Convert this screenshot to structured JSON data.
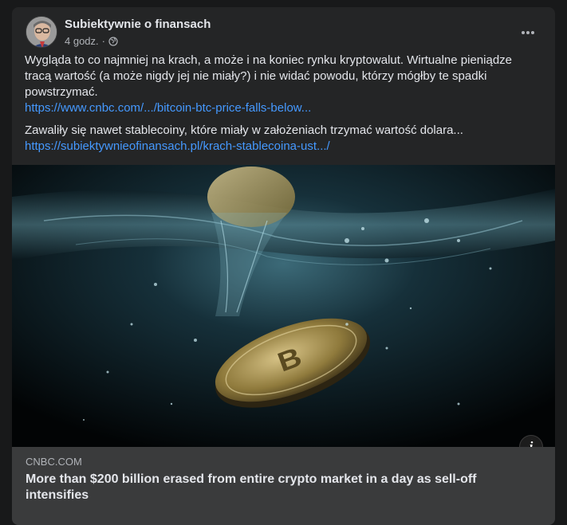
{
  "post": {
    "page_name": "Subiektywnie o finansach",
    "time": "4 godz.",
    "separator": "·",
    "paragraph1": "Wygląda to co najmniej na krach, a może i na koniec rynku kryptowalut. Wirtualne pieniądze tracą wartość (a może nigdy jej nie miały?) i nie widać powodu, którzy mógłby te spadki powstrzymać.",
    "link1": "https://www.cnbc.com/.../bitcoin-btc-price-falls-below...",
    "paragraph2": "Zawaliły się nawet stablecoiny, które miały w założeniach trzymać wartość dolara...",
    "link2": "https://subiektywnieofinansach.pl/krach-stablecoina-ust.../",
    "more_label": "•••"
  },
  "link_preview": {
    "domain": "CNBC.COM",
    "headline": "More than $200 billion erased from entire crypto market in a day as sell-off intensifies",
    "info_label": "i"
  },
  "icons": {
    "privacy": "globe-icon",
    "more": "more-options-icon",
    "info": "info-icon"
  },
  "colors": {
    "background": "#18191a",
    "card": "#242526",
    "link": "#4599ff",
    "preview_bg": "#3a3b3c"
  }
}
